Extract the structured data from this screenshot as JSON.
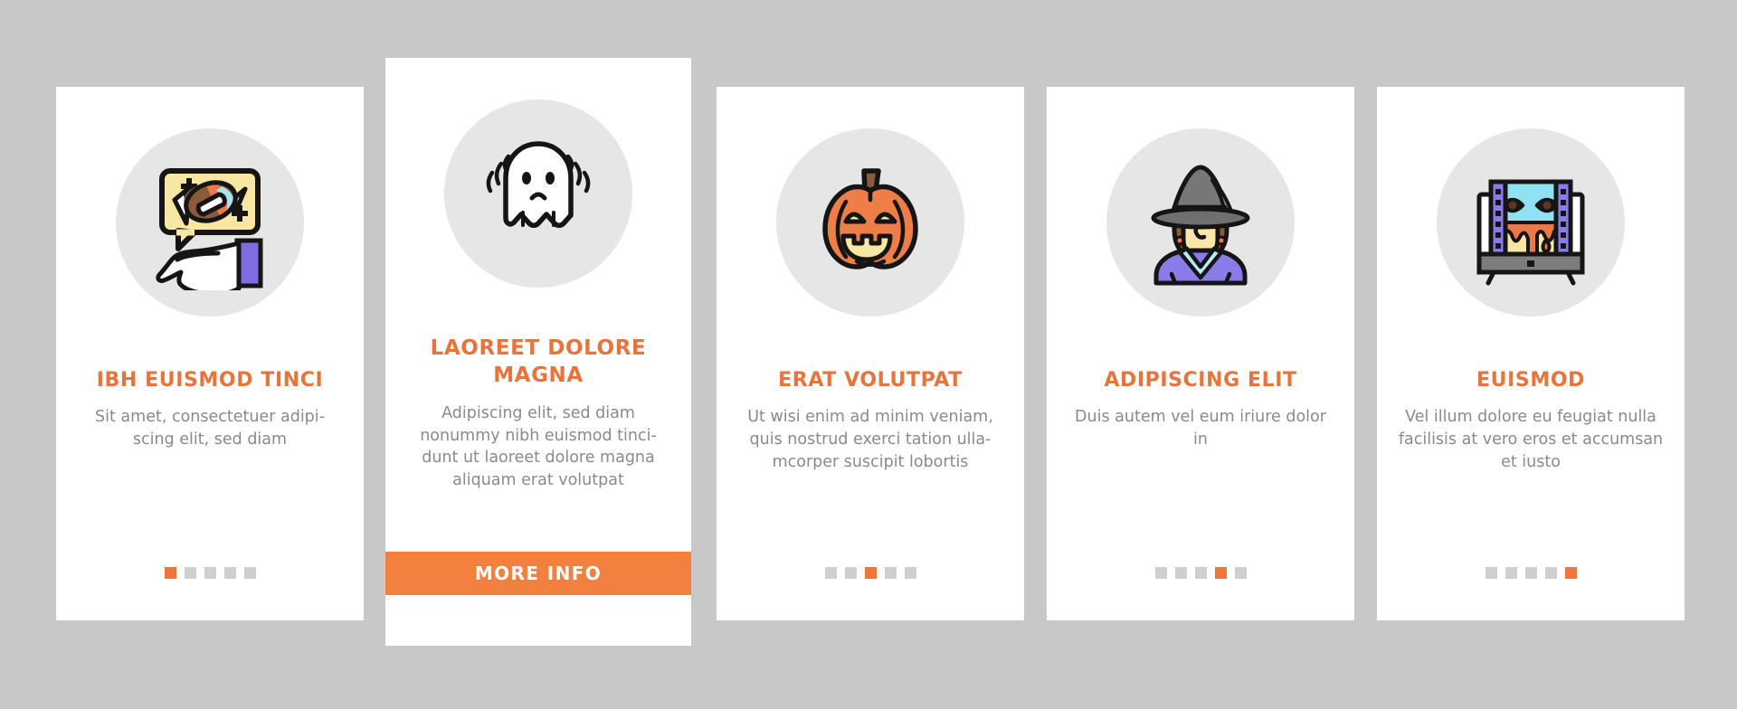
{
  "theme": {
    "background": "#c8c8c8",
    "card_background": "#ffffff",
    "accent": "#e8743b",
    "button_background": "#f2803f",
    "body_text": "#8a8a8a",
    "dot_inactive": "#cfcfcf",
    "dot_active": "#f2763a",
    "icon_circle": "#e6e6e6"
  },
  "screens": [
    {
      "icon_name": "hand-holding-candy-speech-bubble-icon",
      "title": "IBH EUISMOD TINCI",
      "body": "Sit amet, consectetuer adipi-scing elit, sed diam",
      "dots": {
        "count": 5,
        "active_index": 0
      },
      "button": null
    },
    {
      "icon_name": "ghost-icon",
      "title": "LAOREET DOLORE MAGNA",
      "body": "Adipiscing elit, sed diam nonummy nibh euismod tinci-dunt ut laoreet dolore magna aliquam erat volutpat",
      "dots": null,
      "button": {
        "label": "MORE INFO"
      }
    },
    {
      "icon_name": "jack-o-lantern-pumpkin-icon",
      "title": "ERAT VOLUTPAT",
      "body": "Ut wisi enim ad minim veniam, quis nostrud exerci tation ulla-mcorper suscipit lobortis",
      "dots": {
        "count": 5,
        "active_index": 2
      },
      "button": null
    },
    {
      "icon_name": "witch-icon",
      "title": "ADIPISCING ELIT",
      "body": "Duis autem vel eum iriure dolor in",
      "dots": {
        "count": 5,
        "active_index": 3
      },
      "button": null
    },
    {
      "icon_name": "horror-movie-tv-icon",
      "title": "EUISMOD",
      "body": "Vel illum dolore eu feugiat nulla facilisis at vero eros et accumsan et iusto",
      "dots": {
        "count": 5,
        "active_index": 4
      },
      "button": null
    }
  ]
}
